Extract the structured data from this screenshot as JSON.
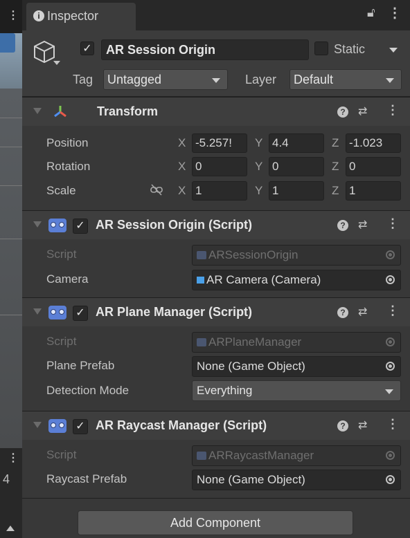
{
  "tab": {
    "title": "Inspector"
  },
  "header": {
    "object_name": "AR Session Origin",
    "active_checked": "✓",
    "static_label": "Static",
    "tag_label": "Tag",
    "tag_value": "Untagged",
    "layer_label": "Layer",
    "layer_value": "Default"
  },
  "transform": {
    "title": "Transform",
    "rows": [
      {
        "label": "Position",
        "x": "-5.257!",
        "y": "4.4",
        "z": "-1.023"
      },
      {
        "label": "Rotation",
        "x": "0",
        "y": "0",
        "z": "0"
      },
      {
        "label": "Scale",
        "x": "1",
        "y": "1",
        "z": "1"
      }
    ],
    "axes": {
      "x": "X",
      "y": "Y",
      "z": "Z"
    }
  },
  "session_origin": {
    "title": "AR Session Origin (Script)",
    "script_label": "Script",
    "script_value": "ARSessionOrigin",
    "camera_label": "Camera",
    "camera_value": "AR Camera (Camera)"
  },
  "plane_manager": {
    "title": "AR Plane Manager (Script)",
    "script_label": "Script",
    "script_value": "ARPlaneManager",
    "prefab_label": "Plane Prefab",
    "prefab_value": "None (Game Object)",
    "mode_label": "Detection Mode",
    "mode_value": "Everything"
  },
  "raycast_manager": {
    "title": "AR Raycast Manager (Script)",
    "script_label": "Script",
    "script_value": "ARRaycastManager",
    "prefab_label": "Raycast Prefab",
    "prefab_value": "None (Game Object)"
  },
  "footer": {
    "add_component": "Add Component"
  },
  "scene_strip": {
    "number": "4"
  },
  "icons": {
    "info": "info-icon",
    "lock": "lock-icon",
    "menu": "kebab-menu-icon",
    "gameobject": "cube-icon",
    "transform": "transform-axes-icon",
    "help": "help-icon",
    "presets": "presets-icon",
    "script": "script-component-icon",
    "link": "unlinked-scale-icon"
  },
  "colors": {
    "accent": "#5b7fd6",
    "panel": "#383838",
    "header": "#3e3e3e"
  }
}
